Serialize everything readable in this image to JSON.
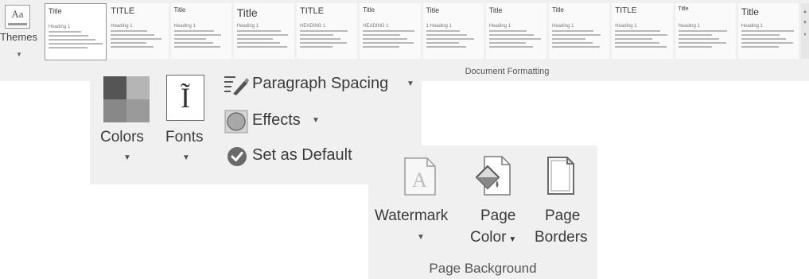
{
  "ribbon": {
    "themes_label": "Themes",
    "themes_icon_text": "Aa",
    "group_label": "Document Formatting",
    "style_gallery": [
      {
        "title": "Title",
        "heading": "Heading 1"
      },
      {
        "title": "TITLE",
        "heading": "Heading 1"
      },
      {
        "title": "Title",
        "heading": "Heading 1"
      },
      {
        "title": "Title",
        "heading": "Heading 1"
      },
      {
        "title": "TITLE",
        "heading": "HEADING 1"
      },
      {
        "title": "Title",
        "heading": "HEADING 1"
      },
      {
        "title": "Title",
        "heading": "1 Heading 1"
      },
      {
        "title": "Title",
        "heading": "Heading 1"
      },
      {
        "title": "Title",
        "heading": "Heading 1"
      },
      {
        "title": "TITLE",
        "heading": "Heading 1"
      },
      {
        "title": "Title",
        "heading": "Heading 1"
      },
      {
        "title": "Title",
        "heading": "Heading 1"
      }
    ]
  },
  "document_formatting": {
    "colors_label": "Colors",
    "fonts_label": "Fonts",
    "paragraph_spacing_label": "Paragraph Spacing",
    "effects_label": "Effects",
    "set_default_label": "Set as Default",
    "colors_palette": [
      "#555555",
      "#b5b5b5",
      "#888888",
      "#9a9a9a"
    ]
  },
  "page_background": {
    "watermark_label": "Watermark",
    "page_color_line1": "Page",
    "page_color_line2": "Color",
    "page_borders_line1": "Page",
    "page_borders_line2": "Borders",
    "group_label": "Page Background"
  }
}
